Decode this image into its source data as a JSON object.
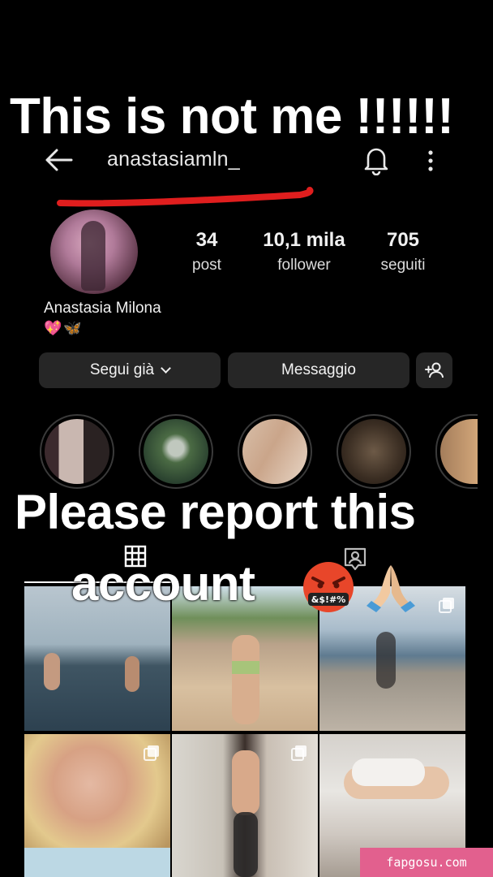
{
  "header": {
    "username": "anastasiamln_"
  },
  "profile": {
    "stats": [
      {
        "value": "34",
        "label": "post"
      },
      {
        "value": "10,1 mila",
        "label": "follower"
      },
      {
        "value": "705",
        "label": "seguiti"
      }
    ],
    "full_name": "Anastasia Milona",
    "bio": "💖🦋"
  },
  "actions": {
    "follow_label": "Segui già",
    "message_label": "Messaggio"
  },
  "overlay": {
    "line1": "This is not me !!!!!!",
    "line2": "Please report this",
    "line3": "account",
    "emoji_text": "&$!#%"
  },
  "watermark": "fapgosu.com",
  "colors": {
    "background": "#000000",
    "button": "#262626",
    "annotation_red": "#e01e1e",
    "watermark_bg": "#e2608e"
  },
  "icons": [
    "back-arrow-icon",
    "bell-icon",
    "more-vertical-icon",
    "add-person-icon",
    "grid-icon",
    "tagged-person-icon",
    "multiple-posts-icon"
  ]
}
